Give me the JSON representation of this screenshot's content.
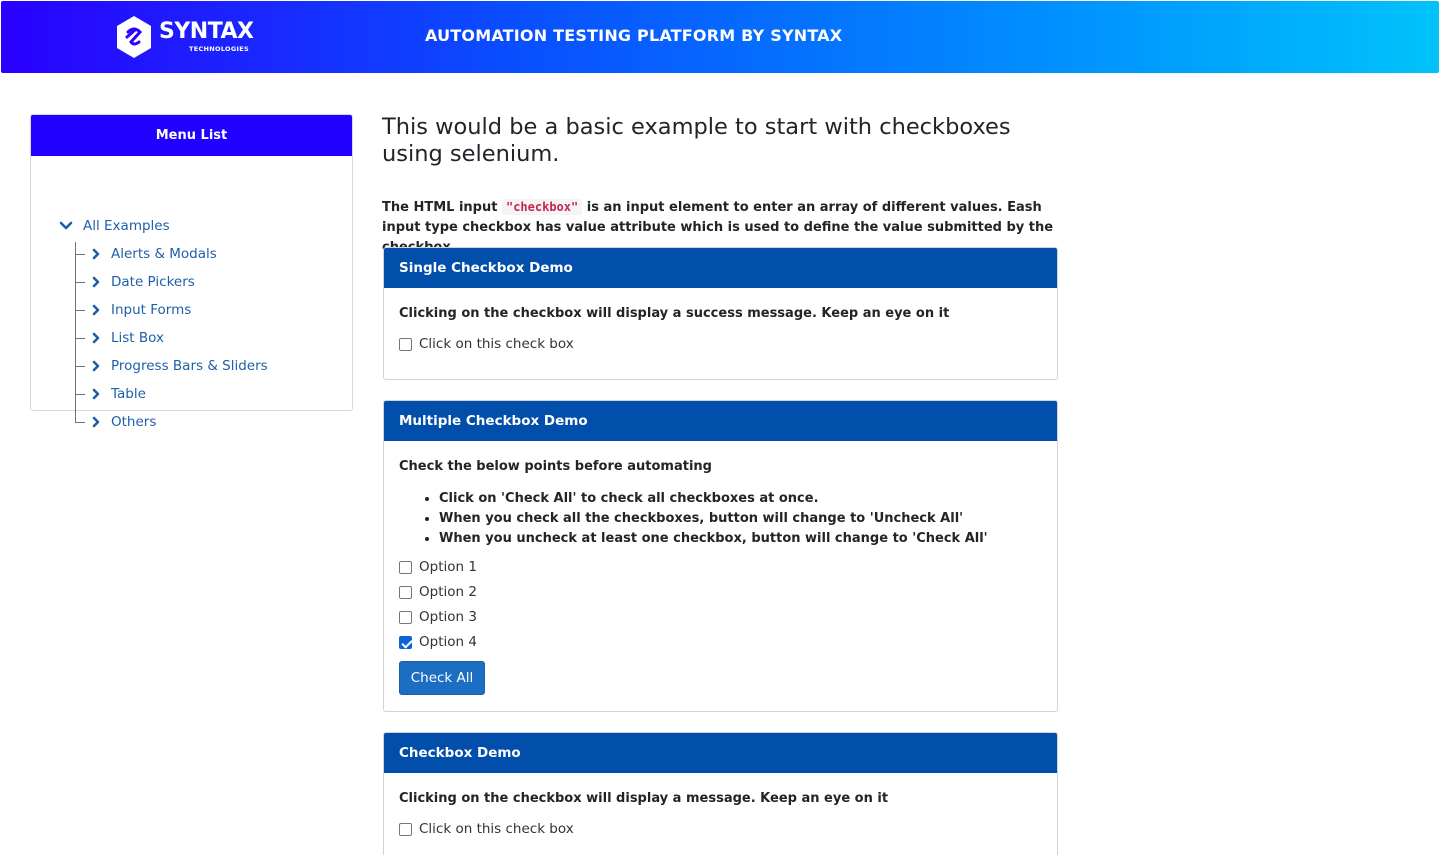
{
  "header": {
    "logo_word": "SYNTAX",
    "logo_sub": "TECHNOLOGIES",
    "title": "AUTOMATION TESTING PLATFORM BY SYNTAX"
  },
  "sidebar": {
    "title": "Menu List",
    "root": {
      "label": "All Examples",
      "icon": "chevron-down-icon"
    },
    "items": [
      {
        "label": "Alerts & Modals",
        "icon": "chevron-right-icon"
      },
      {
        "label": "Date Pickers",
        "icon": "chevron-right-icon"
      },
      {
        "label": "Input Forms",
        "icon": "chevron-right-icon"
      },
      {
        "label": "List Box",
        "icon": "chevron-right-icon"
      },
      {
        "label": "Progress Bars & Sliders",
        "icon": "chevron-right-icon"
      },
      {
        "label": "Table",
        "icon": "chevron-right-icon"
      },
      {
        "label": "Others",
        "icon": "chevron-right-icon"
      }
    ]
  },
  "main": {
    "heading": "This would be a basic example to start with checkboxes using selenium.",
    "intro_before": "The HTML input ",
    "intro_code": "\"checkbox\"",
    "intro_after": " is an input element to enter an array of different values. Eash input type checkbox has value attribute which is used to define the value submitted by the checkbox.",
    "single": {
      "title": "Single Checkbox Demo",
      "text": "Clicking on the checkbox will display a success message. Keep an eye on it",
      "checkbox_label": "Click on this check box",
      "checked": false
    },
    "multiple": {
      "title": "Multiple Checkbox Demo",
      "text": "Check the below points before automating",
      "bullets": [
        "Click on 'Check All' to check all checkboxes at once.",
        "When you check all the checkboxes, button will change to 'Uncheck All'",
        "When you uncheck at least one checkbox, button will change to 'Check All'"
      ],
      "options": [
        {
          "label": "Option 1",
          "checked": false
        },
        {
          "label": "Option 2",
          "checked": false
        },
        {
          "label": "Option 3",
          "checked": false
        },
        {
          "label": "Option 4",
          "checked": true
        }
      ],
      "button_label": "Check All"
    },
    "demo": {
      "title": "Checkbox Demo",
      "text": "Clicking on the checkbox will display a message. Keep an eye on it",
      "checkbox_label": "Click on this check box",
      "checked": false
    }
  },
  "colors": {
    "header_gradient_start": "#2a00ff",
    "header_gradient_end": "#00c3fa",
    "sidebar_head": "#2200ff",
    "panel_head": "#024fab",
    "link": "#1f5fa8",
    "button": "#1b6ec2",
    "checkbox_checked": "#0b64d8"
  }
}
